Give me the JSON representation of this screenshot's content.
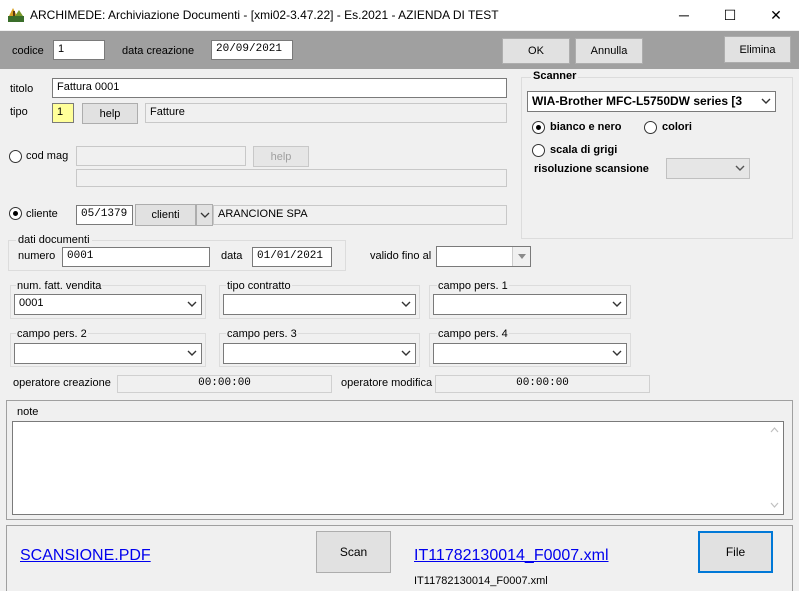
{
  "window": {
    "title": "ARCHIMEDE: Archiviazione Documenti - [xmi02-3.47.22] - Es.2021 - AZIENDA DI TEST",
    "minimize_glyph": "─",
    "maximize_glyph": "☐",
    "close_glyph": "✕"
  },
  "toolbar": {
    "codice_label": "codice",
    "codice_value": "1",
    "data_creazione_label": "data creazione",
    "data_creazione_value": "20/09/2021",
    "ok_label": "OK",
    "annulla_label": "Annulla",
    "elimina_label": "Elimina"
  },
  "form": {
    "titolo_label": "titolo",
    "titolo_value": "Fattura 0001",
    "tipo_label": "tipo",
    "tipo_value": "1",
    "help_label": "help",
    "tipo_desc": "Fatture",
    "cod_mag_label": "cod mag",
    "cod_mag_value": "",
    "cod_mag_help_label": "help",
    "cod_mag_desc": "",
    "cliente_label": "cliente",
    "cliente_code": "05/1379",
    "clienti_label": "clienti",
    "cliente_name": "ARANCIONE SPA",
    "dati_documenti_label": "dati documenti",
    "numero_label": "numero",
    "numero_value": "0001",
    "data_label": "data",
    "data_value": "01/01/2021",
    "valido_label": "valido fino al",
    "valido_value": ""
  },
  "scanner": {
    "group_label": "Scanner",
    "device": "WIA-Brother MFC-L5750DW series [3",
    "bianco_nero_label": "bianco e nero",
    "colori_label": "colori",
    "scala_grigi_label": "scala di grigi",
    "risoluzione_label": "risoluzione scansione",
    "risoluzione_value": ""
  },
  "combos": {
    "num_fatt_label": "num. fatt. vendita",
    "num_fatt_value": "0001",
    "tipo_contratto_label": "tipo contratto",
    "tipo_contratto_value": "",
    "campo1_label": "campo pers. 1",
    "campo1_value": "",
    "campo2_label": "campo pers. 2",
    "campo2_value": "",
    "campo3_label": "campo pers. 3",
    "campo3_value": "",
    "campo4_label": "campo pers. 4",
    "campo4_value": ""
  },
  "operators": {
    "creazione_label": "operatore creazione",
    "creazione_value": "00:00:00",
    "modifica_label": "operatore modifica",
    "modifica_value": "00:00:00"
  },
  "note": {
    "label": "note",
    "value": ""
  },
  "bottom": {
    "scan_file_link": "SCANSIONE.PDF",
    "scan_button": "Scan",
    "xml_link": "IT11782130014_F0007.xml",
    "xml_caption": "IT11782130014_F0007.xml",
    "file_button": "File"
  },
  "colors": {
    "toolbar_bg": "#a0a0a0",
    "tipo_field_bg": "#ffff99",
    "link": "#0000ee"
  },
  "icons": {
    "app": "archimede-app-icon",
    "dropdown": "chevron-down-icon",
    "scroll_up": "scroll-up-arrow-icon",
    "scroll_down": "scroll-down-arrow-icon"
  }
}
